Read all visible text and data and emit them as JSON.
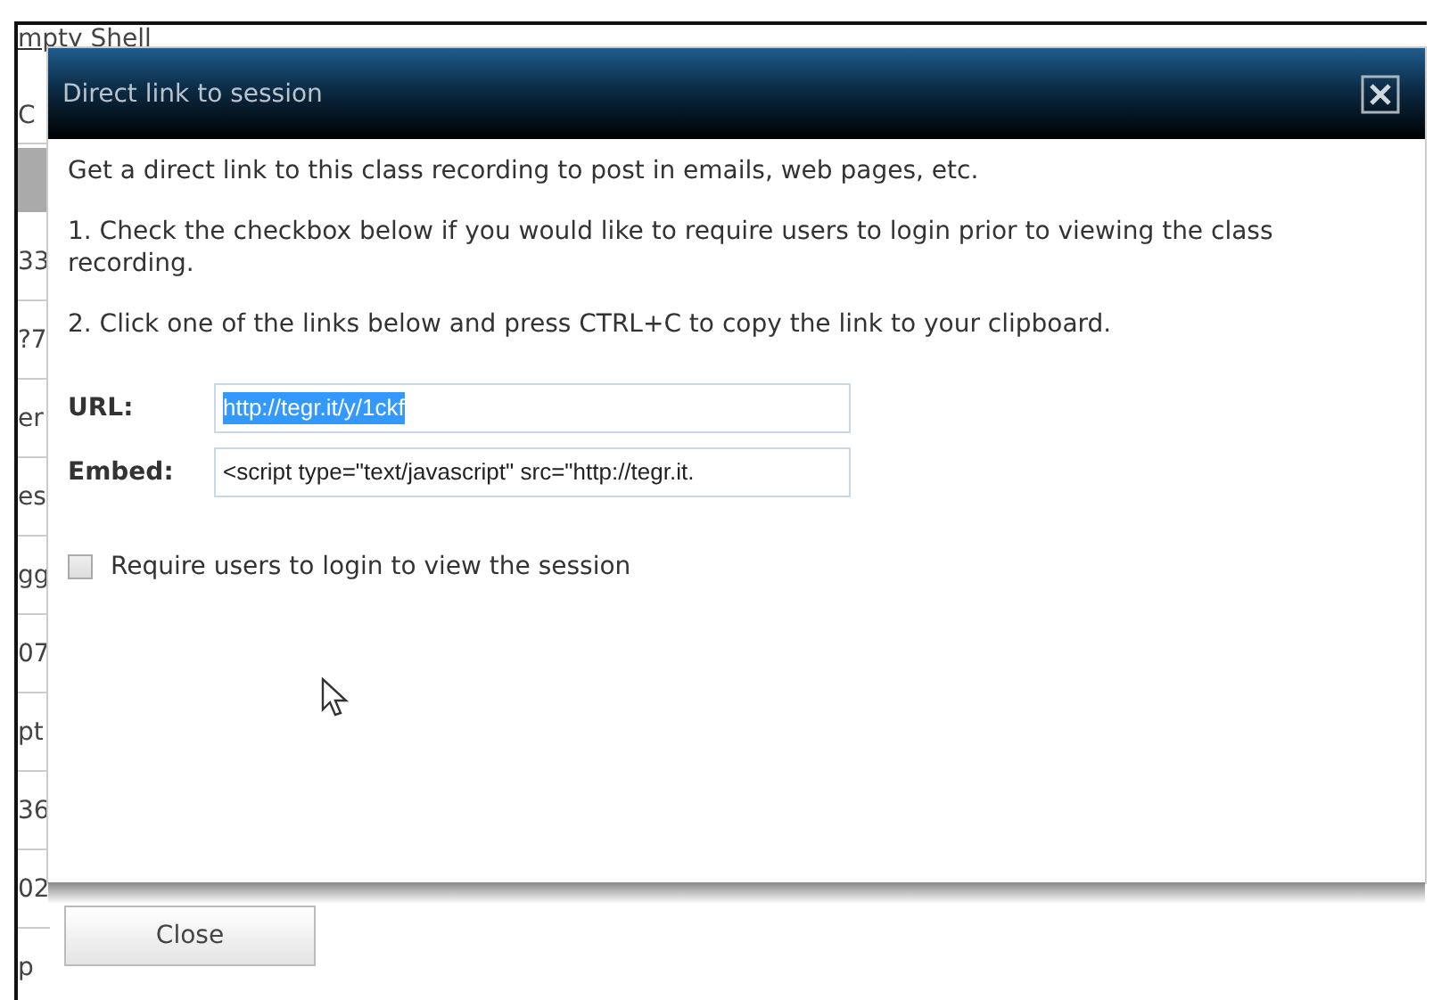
{
  "background_page": {
    "header": "mpty Shell",
    "cells": [
      "C",
      "33",
      "?7",
      "er",
      "es",
      "gg",
      "07",
      "pt",
      "36",
      "02",
      "p"
    ]
  },
  "dialog": {
    "title": "Direct link to session",
    "paragraphs": [
      "Get a direct link to this class recording to post in emails, web pages, etc.",
      "1. Check the checkbox below if you would like to require users to login prior to viewing the class recording.",
      "2. Click one of the links below and press CTRL+C to copy the link to your clipboard."
    ],
    "fields": [
      {
        "label": "URL:",
        "value": "http://tegr.it/y/1ckf",
        "selected": true
      },
      {
        "label": "Embed:",
        "value": "<script type=\"text/javascript\" src=\"http://tegr.it.",
        "selected": false
      }
    ],
    "checkbox": {
      "label": "Require users to login to view the session",
      "checked": false
    },
    "buttons": [
      "Close"
    ]
  }
}
